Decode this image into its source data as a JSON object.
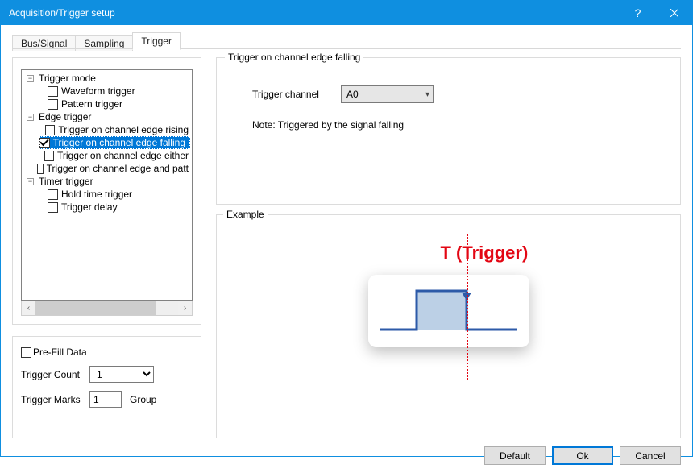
{
  "window": {
    "title": "Acquisition/Trigger setup"
  },
  "tabs": [
    {
      "label": "Bus/Signal",
      "active": false
    },
    {
      "label": "Sampling",
      "active": false
    },
    {
      "label": "Trigger",
      "active": true
    }
  ],
  "tree": {
    "trigger_mode": {
      "label": "Trigger mode",
      "children": {
        "waveform": {
          "label": "Waveform trigger",
          "checked": false
        },
        "pattern": {
          "label": "Pattern trigger",
          "checked": false
        }
      }
    },
    "edge_trigger": {
      "label": "Edge trigger",
      "children": {
        "rising": {
          "label": "Trigger on channel edge rising",
          "checked": false
        },
        "falling": {
          "label": "Trigger on channel edge falling",
          "checked": true
        },
        "either": {
          "label": "Trigger on channel edge either",
          "checked": false
        },
        "and_patt": {
          "label": "Trigger on channel edge and patt",
          "checked": false
        }
      }
    },
    "timer_trigger": {
      "label": "Timer trigger",
      "children": {
        "hold": {
          "label": "Hold time trigger",
          "checked": false
        },
        "delay": {
          "label": "Trigger delay",
          "checked": false
        }
      }
    }
  },
  "options": {
    "prefill_label": "Pre-Fill Data",
    "prefill_checked": false,
    "trigger_count_label": "Trigger Count",
    "trigger_count_value": "1",
    "trigger_marks_label": "Trigger Marks",
    "trigger_marks_value": "1",
    "trigger_marks_unit": "Group"
  },
  "right": {
    "legend": "Trigger on channel edge falling",
    "channel_label": "Trigger channel",
    "channel_value": "A0",
    "note": "Note: Triggered by the signal falling"
  },
  "example": {
    "legend": "Example",
    "title": "T (Trigger)"
  },
  "buttons": {
    "default": "Default",
    "ok": "Ok",
    "cancel": "Cancel"
  },
  "colors": {
    "accent": "#0f8fe0",
    "select": "#0078d7",
    "danger": "#e30613",
    "wave_fill": "#bcd0e6",
    "wave_stroke": "#2d5aa8"
  }
}
